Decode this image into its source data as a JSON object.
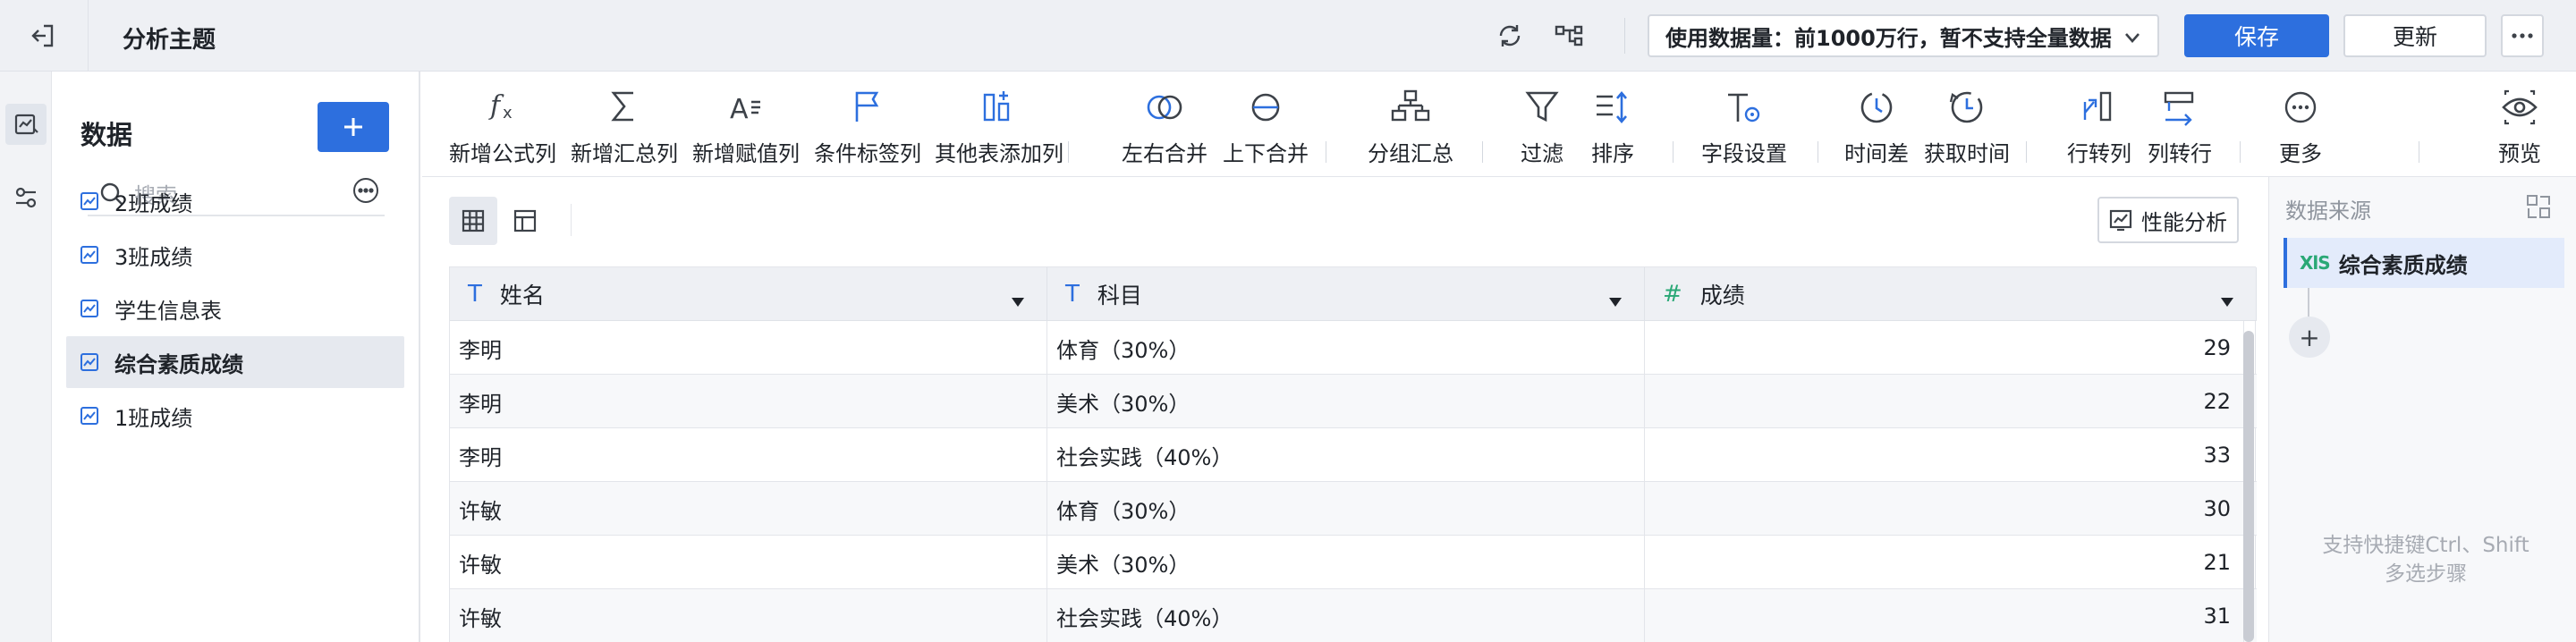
{
  "header": {
    "title": "分析主题",
    "data_usage": "使用数据量：前1000万行，暂不支持全量数据",
    "save_label": "保存",
    "update_label": "更新"
  },
  "panel": {
    "title": "数据",
    "search_placeholder": "搜索",
    "items": [
      {
        "label": "2班成绩",
        "selected": false
      },
      {
        "label": "3班成绩",
        "selected": false
      },
      {
        "label": "学生信息表",
        "selected": false
      },
      {
        "label": "综合素质成绩",
        "selected": true
      },
      {
        "label": "1班成绩",
        "selected": false
      }
    ]
  },
  "toolbar": {
    "tools": [
      {
        "label": "新增公式列",
        "icon": "formula-icon"
      },
      {
        "label": "新增汇总列",
        "icon": "sum-icon"
      },
      {
        "label": "新增赋值列",
        "icon": "assign-icon"
      },
      {
        "label": "条件标签列",
        "icon": "flag-icon"
      },
      {
        "label": "其他表添加列",
        "icon": "add-column-icon"
      },
      {
        "label": "左右合并",
        "icon": "merge-lr-icon"
      },
      {
        "label": "上下合并",
        "icon": "merge-tb-icon"
      },
      {
        "label": "分组汇总",
        "icon": "group-icon"
      },
      {
        "label": "过滤",
        "icon": "filter-icon"
      },
      {
        "label": "排序",
        "icon": "sort-icon"
      },
      {
        "label": "字段设置",
        "icon": "field-settings-icon"
      },
      {
        "label": "时间差",
        "icon": "time-diff-icon"
      },
      {
        "label": "获取时间",
        "icon": "get-time-icon"
      },
      {
        "label": "行转列",
        "icon": "row-to-col-icon"
      },
      {
        "label": "列转行",
        "icon": "col-to-row-icon"
      },
      {
        "label": "更多",
        "icon": "more-icon"
      },
      {
        "label": "预览",
        "icon": "preview-icon"
      }
    ]
  },
  "main": {
    "perf_label": "性能分析",
    "columns": [
      {
        "label": "姓名",
        "type_glyph": "T",
        "kind": "text"
      },
      {
        "label": "科目",
        "type_glyph": "T",
        "kind": "text"
      },
      {
        "label": "成绩",
        "type_glyph": "#",
        "kind": "number"
      }
    ],
    "rows": [
      [
        "李明",
        "体育（30%）",
        "29"
      ],
      [
        "李明",
        "美术（30%）",
        "22"
      ],
      [
        "李明",
        "社会实践（40%）",
        "33"
      ],
      [
        "许敏",
        "体育（30%）",
        "30"
      ],
      [
        "许敏",
        "美术（30%）",
        "21"
      ],
      [
        "许敏",
        "社会实践（40%）",
        "31"
      ]
    ]
  },
  "right_panel": {
    "title": "数据来源",
    "source_badge": "XlS",
    "source_name": "综合素质成绩",
    "add_label": "+",
    "hint_line1": "支持快捷键Ctrl、Shift",
    "hint_line2": "多选步骤"
  },
  "colors": {
    "accent": "#2d6fde",
    "header_bg": "#eef0f4",
    "number_type": "#2aa876"
  }
}
